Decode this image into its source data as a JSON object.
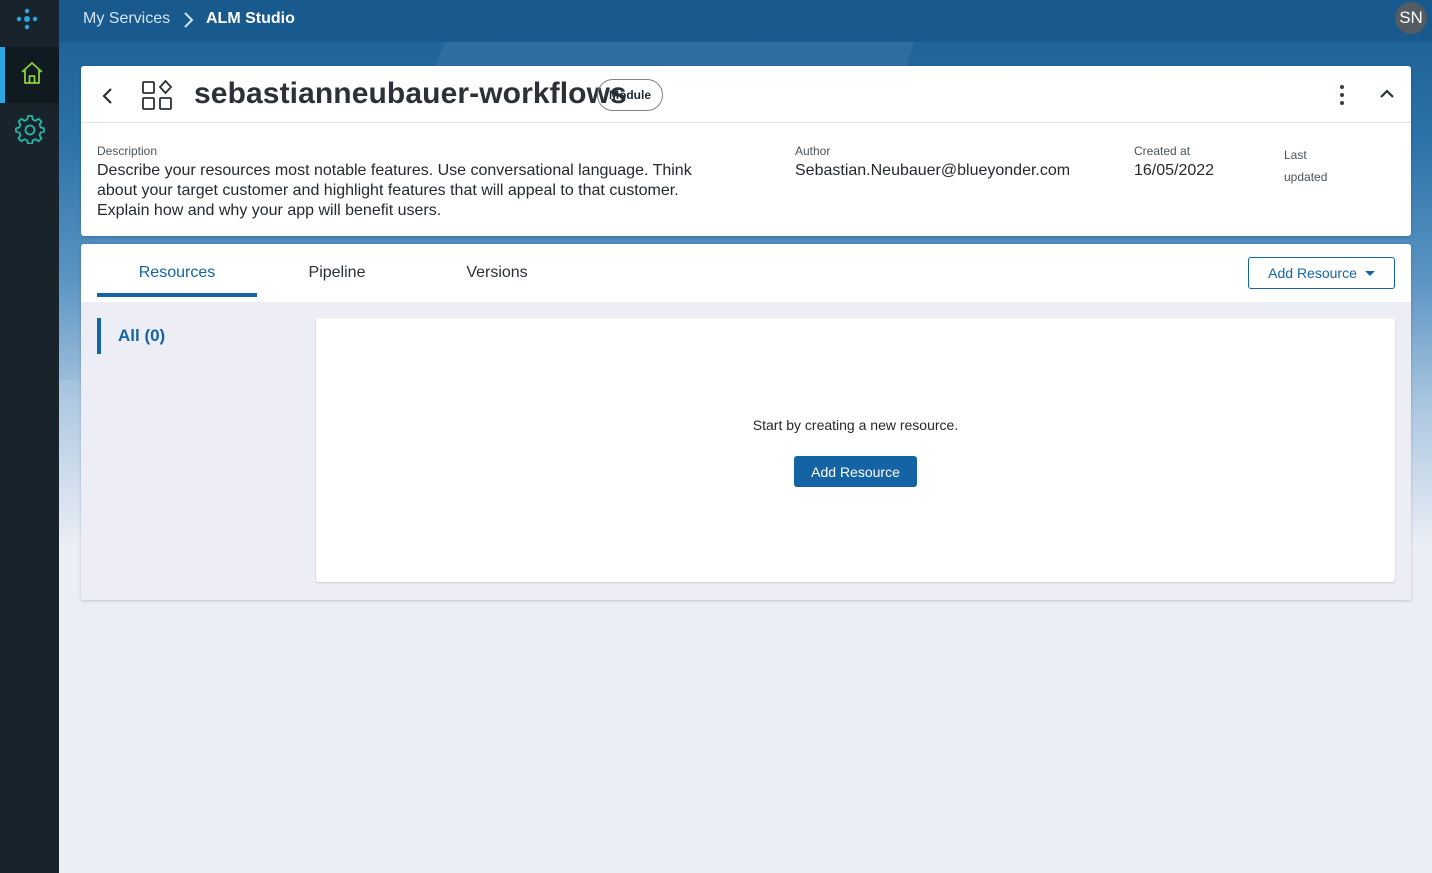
{
  "topbar": {
    "breadcrumb": [
      "My Services",
      "ALM Studio"
    ],
    "avatar_initials": "SN"
  },
  "rail": {
    "items": [
      {
        "icon": "home-icon",
        "active": true
      },
      {
        "icon": "gear-icon",
        "active": false
      }
    ]
  },
  "header": {
    "title": "sebastianneubauer-workflows",
    "badge": "Module",
    "description_label": "Description",
    "description": "Describe your resources most notable features. Use conversational language. Think about your target customer and highlight features that will appeal to that customer. Explain how and why your app will benefit users.",
    "author_label": "Author",
    "author": "Sebastian.Neubauer@blueyonder.com",
    "created_label": "Created at",
    "created": "16/05/2022",
    "updated_label": "Last updated"
  },
  "tabs": {
    "items": [
      "Resources",
      "Pipeline",
      "Versions"
    ],
    "active": "Resources",
    "add_resource_label": "Add Resource"
  },
  "resources": {
    "filter_label": "All (0)",
    "empty_message": "Start by creating a new resource.",
    "add_button_label": "Add Resource"
  },
  "colors": {
    "accent": "#1464a5",
    "rail": "#18232b",
    "topbar": "#185a8e",
    "active_indicator": "#2aa6e4",
    "home_icon": "#8ccf3c",
    "gear_icon": "#25b7a6"
  }
}
